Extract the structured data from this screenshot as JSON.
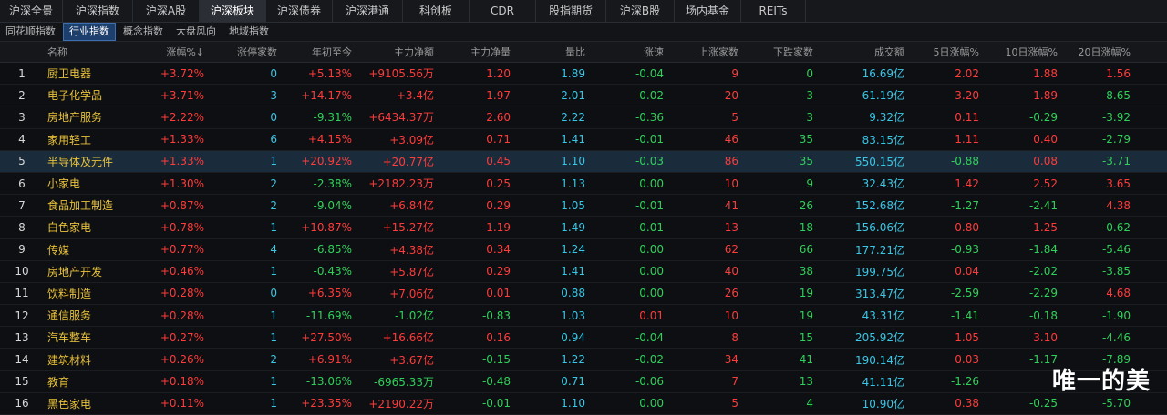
{
  "top_tabs": [
    "沪深全景",
    "沪深指数",
    "沪深A股",
    "沪深板块",
    "沪深债券",
    "沪深港通",
    "科创板",
    "CDR",
    "股指期货",
    "沪深B股",
    "场内基金",
    "REITs"
  ],
  "top_tabs_active": 3,
  "sub_tabs": [
    "同花顺指数",
    "行业指数",
    "概念指数",
    "大盘风向",
    "地域指数"
  ],
  "sub_tabs_active": 1,
  "headers": [
    "",
    "名称",
    "涨幅%↓",
    "涨停家数",
    "年初至今",
    "主力净额",
    "主力净量",
    "量比",
    "涨速",
    "上涨家数",
    "下跌家数",
    "成交额",
    "5日涨幅%",
    "10日涨幅%",
    "20日涨幅%"
  ],
  "rows": [
    {
      "idx": "1",
      "name": "厨卫电器",
      "chg": "+3.72%",
      "lim": "0",
      "ytd": "+5.13%",
      "net": "+9105.56万",
      "netvol": "1.20",
      "vr": "1.89",
      "spd": "-0.04",
      "up": "9",
      "down": "0",
      "amt": "16.69亿",
      "d5": "2.02",
      "d10": "1.88",
      "d20": "1.56"
    },
    {
      "idx": "2",
      "name": "电子化学品",
      "chg": "+3.71%",
      "lim": "3",
      "ytd": "+14.17%",
      "net": "+3.4亿",
      "netvol": "1.97",
      "vr": "2.01",
      "spd": "-0.02",
      "up": "20",
      "down": "3",
      "amt": "61.19亿",
      "d5": "3.20",
      "d10": "1.89",
      "d20": "-8.65"
    },
    {
      "idx": "3",
      "name": "房地产服务",
      "chg": "+2.22%",
      "lim": "0",
      "ytd": "-9.31%",
      "net": "+6434.37万",
      "netvol": "2.60",
      "vr": "2.22",
      "spd": "-0.36",
      "up": "5",
      "down": "3",
      "amt": "9.32亿",
      "d5": "0.11",
      "d10": "-0.29",
      "d20": "-3.92"
    },
    {
      "idx": "4",
      "name": "家用轻工",
      "chg": "+1.33%",
      "lim": "6",
      "ytd": "+4.15%",
      "net": "+3.09亿",
      "netvol": "0.71",
      "vr": "1.41",
      "spd": "-0.01",
      "up": "46",
      "down": "35",
      "amt": "83.15亿",
      "d5": "1.11",
      "d10": "0.40",
      "d20": "-2.79"
    },
    {
      "idx": "5",
      "name": "半导体及元件",
      "chg": "+1.33%",
      "lim": "1",
      "ytd": "+20.92%",
      "net": "+20.77亿",
      "netvol": "0.45",
      "vr": "1.10",
      "spd": "-0.03",
      "up": "86",
      "down": "35",
      "amt": "550.15亿",
      "d5": "-0.88",
      "d10": "0.08",
      "d20": "-3.71"
    },
    {
      "idx": "6",
      "name": "小家电",
      "chg": "+1.30%",
      "lim": "2",
      "ytd": "-2.38%",
      "net": "+2182.23万",
      "netvol": "0.25",
      "vr": "1.13",
      "spd": "0.00",
      "up": "10",
      "down": "9",
      "amt": "32.43亿",
      "d5": "1.42",
      "d10": "2.52",
      "d20": "3.65"
    },
    {
      "idx": "7",
      "name": "食品加工制造",
      "chg": "+0.87%",
      "lim": "2",
      "ytd": "-9.04%",
      "net": "+6.84亿",
      "netvol": "0.29",
      "vr": "1.05",
      "spd": "-0.01",
      "up": "41",
      "down": "26",
      "amt": "152.68亿",
      "d5": "-1.27",
      "d10": "-2.41",
      "d20": "4.38"
    },
    {
      "idx": "8",
      "name": "白色家电",
      "chg": "+0.78%",
      "lim": "1",
      "ytd": "+10.87%",
      "net": "+15.27亿",
      "netvol": "1.19",
      "vr": "1.49",
      "spd": "-0.01",
      "up": "13",
      "down": "18",
      "amt": "156.06亿",
      "d5": "0.80",
      "d10": "1.25",
      "d20": "-0.62"
    },
    {
      "idx": "9",
      "name": "传媒",
      "chg": "+0.77%",
      "lim": "4",
      "ytd": "-6.85%",
      "net": "+4.38亿",
      "netvol": "0.34",
      "vr": "1.24",
      "spd": "0.00",
      "up": "62",
      "down": "66",
      "amt": "177.21亿",
      "d5": "-0.93",
      "d10": "-1.84",
      "d20": "-5.46"
    },
    {
      "idx": "10",
      "name": "房地产开发",
      "chg": "+0.46%",
      "lim": "1",
      "ytd": "-0.43%",
      "net": "+5.87亿",
      "netvol": "0.29",
      "vr": "1.41",
      "spd": "0.00",
      "up": "40",
      "down": "38",
      "amt": "199.75亿",
      "d5": "0.04",
      "d10": "-2.02",
      "d20": "-3.85"
    },
    {
      "idx": "11",
      "name": "饮料制造",
      "chg": "+0.28%",
      "lim": "0",
      "ytd": "+6.35%",
      "net": "+7.06亿",
      "netvol": "0.01",
      "vr": "0.88",
      "spd": "0.00",
      "up": "26",
      "down": "19",
      "amt": "313.47亿",
      "d5": "-2.59",
      "d10": "-2.29",
      "d20": "4.68"
    },
    {
      "idx": "12",
      "name": "通信服务",
      "chg": "+0.28%",
      "lim": "1",
      "ytd": "-11.69%",
      "net": "-1.02亿",
      "netvol": "-0.83",
      "vr": "1.03",
      "spd": "0.01",
      "up": "10",
      "down": "19",
      "amt": "43.31亿",
      "d5": "-1.41",
      "d10": "-0.18",
      "d20": "-1.90"
    },
    {
      "idx": "13",
      "name": "汽车整车",
      "chg": "+0.27%",
      "lim": "1",
      "ytd": "+27.50%",
      "net": "+16.66亿",
      "netvol": "0.16",
      "vr": "0.94",
      "spd": "-0.04",
      "up": "8",
      "down": "15",
      "amt": "205.92亿",
      "d5": "1.05",
      "d10": "3.10",
      "d20": "-4.46"
    },
    {
      "idx": "14",
      "name": "建筑材料",
      "chg": "+0.26%",
      "lim": "2",
      "ytd": "+6.91%",
      "net": "+3.67亿",
      "netvol": "-0.15",
      "vr": "1.22",
      "spd": "-0.02",
      "up": "34",
      "down": "41",
      "amt": "190.14亿",
      "d5": "0.03",
      "d10": "-1.17",
      "d20": "-7.89"
    },
    {
      "idx": "15",
      "name": "教育",
      "chg": "+0.18%",
      "lim": "1",
      "ytd": "-13.06%",
      "net": "-6965.33万",
      "netvol": "-0.48",
      "vr": "0.71",
      "spd": "-0.06",
      "up": "7",
      "down": "13",
      "amt": "41.11亿",
      "d5": "-1.26",
      "d10": "",
      "": "",
      "d20": ""
    },
    {
      "idx": "16",
      "name": "黑色家电",
      "chg": "+0.11%",
      "lim": "1",
      "ytd": "+23.35%",
      "net": "+2190.22万",
      "netvol": "-0.01",
      "vr": "1.10",
      "spd": "0.00",
      "up": "5",
      "down": "4",
      "amt": "10.90亿",
      "d5": "0.38",
      "d10": "-0.25",
      "d20": "-5.70"
    }
  ],
  "watermark": "唯一的美",
  "colors": {
    "up": "#ff3b3b",
    "down": "#2fd15a",
    "neutral": "#39c7e6",
    "name": "#e8c23a",
    "selected_row": "#1a2c3c"
  }
}
